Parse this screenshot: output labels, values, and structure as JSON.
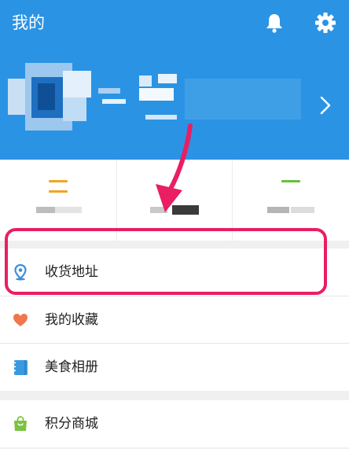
{
  "header": {
    "title": "我的",
    "bg_color": "#2b93e4",
    "icons": [
      "bell-icon",
      "gear-icon",
      "chevron-right-icon"
    ]
  },
  "stats": {
    "bar_colors": [
      "#f0a522",
      "#1f1f1f",
      "#65c235"
    ]
  },
  "menu": {
    "items": [
      {
        "label": "收货地址",
        "icon": "location-pin-icon",
        "color": "#3b8edb"
      },
      {
        "label": "我的收藏",
        "icon": "heart-icon",
        "color": "#f0764d"
      },
      {
        "label": "美食相册",
        "icon": "album-icon",
        "color": "#3a9ae0"
      },
      {
        "label": "积分商城",
        "icon": "shopping-bag-icon",
        "color": "#7cc242"
      }
    ]
  },
  "annotation": {
    "color": "#e91e63"
  }
}
